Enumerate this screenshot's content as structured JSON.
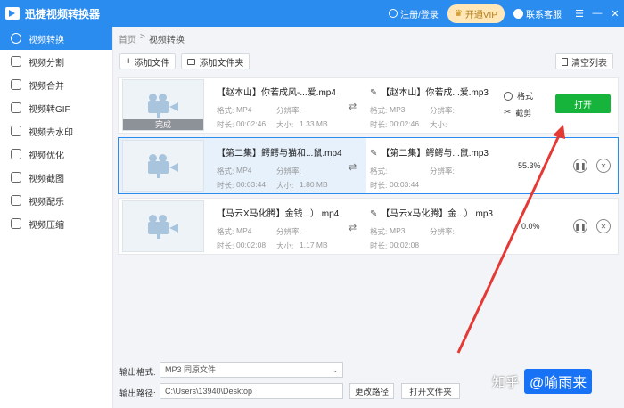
{
  "app": {
    "title": "迅捷视频转换器"
  },
  "header": {
    "login": "注册/登录",
    "vip": "开通VIP",
    "service": "联系客服"
  },
  "sidebar": {
    "items": [
      {
        "label": "视频转换"
      },
      {
        "label": "视频分割"
      },
      {
        "label": "视频合并"
      },
      {
        "label": "视频转GIF"
      },
      {
        "label": "视频去水印"
      },
      {
        "label": "视频优化"
      },
      {
        "label": "视频截图"
      },
      {
        "label": "视频配乐"
      },
      {
        "label": "视频压缩"
      }
    ]
  },
  "breadcrumb": {
    "home": "首页",
    "sep": ">",
    "current": "视频转换"
  },
  "toolbar": {
    "add_file": "添加文件",
    "add_folder": "添加文件夹",
    "clear": "清空列表"
  },
  "meta_labels": {
    "format": "格式:",
    "resolution": "分辨率:",
    "duration": "时长:",
    "size": "大小:"
  },
  "files": [
    {
      "src_name": "【赵本山】你若成风-...爱.mp4",
      "src_format": "MP4",
      "src_duration": "00:02:46",
      "src_size": "1.33 MB",
      "dst_name": "【赵本山】你若成...爱.mp3",
      "dst_format": "MP3",
      "dst_duration": "00:02:46",
      "done_label": "完成",
      "opt_format": "格式",
      "opt_cut": "截剪",
      "open_label": "打开"
    },
    {
      "src_name": "【第二集】鳄鳄与猫和...鼠.mp4",
      "src_format": "MP4",
      "src_duration": "00:03:44",
      "src_size": "1.80 MB",
      "dst_name": "【第二集】鳄鳄与...鼠.mp3",
      "dst_duration": "00:03:44",
      "progress": "55.3%"
    },
    {
      "src_name": "【马云X马化腾】金钱...）.mp4",
      "src_format": "MP4",
      "src_duration": "00:02:08",
      "src_size": "1.17 MB",
      "dst_name": "【马云x马化腾】金...）.mp3",
      "dst_format": "MP3",
      "dst_duration": "00:02:08",
      "progress": "0.0%"
    }
  ],
  "output": {
    "format_label": "输出格式:",
    "format_value": "MP3  同原文件",
    "path_label": "输出路径:",
    "path_value": "C:\\Users\\13940\\Desktop",
    "change_path": "更改路径",
    "open_folder": "打开文件夹"
  },
  "watermark": {
    "site": "知乎",
    "author": "@喻雨来"
  },
  "colors": {
    "accent": "#2b8cf0",
    "open_button": "#16b43a",
    "arrow": "#e53935"
  }
}
